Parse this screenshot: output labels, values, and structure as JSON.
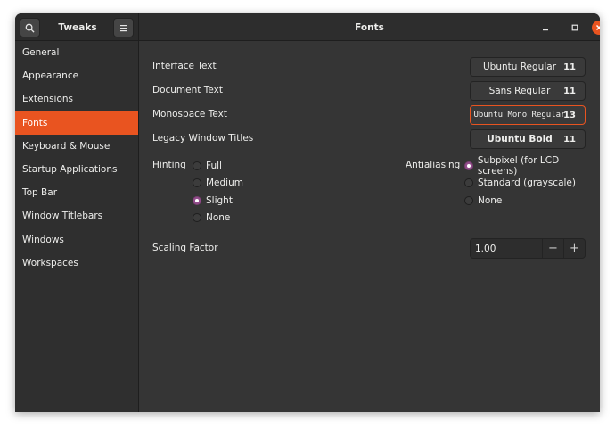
{
  "sidebar": {
    "title": "Tweaks",
    "items": [
      {
        "label": "General"
      },
      {
        "label": "Appearance"
      },
      {
        "label": "Extensions"
      },
      {
        "label": "Fonts"
      },
      {
        "label": "Keyboard & Mouse"
      },
      {
        "label": "Startup Applications"
      },
      {
        "label": "Top Bar"
      },
      {
        "label": "Window Titlebars"
      },
      {
        "label": "Windows"
      },
      {
        "label": "Workspaces"
      }
    ],
    "active_index": 3
  },
  "header": {
    "title": "Fonts"
  },
  "fonts": {
    "interface": {
      "label": "Interface Text",
      "font": "Ubuntu Regular",
      "size": "11"
    },
    "document": {
      "label": "Document Text",
      "font": "Sans Regular",
      "size": "11"
    },
    "monospace": {
      "label": "Monospace Text",
      "font": "Ubuntu Mono Regular",
      "size": "13"
    },
    "legacy": {
      "label": "Legacy Window Titles",
      "font": "Ubuntu Bold",
      "size": "11"
    }
  },
  "hinting": {
    "label": "Hinting",
    "options": [
      "Full",
      "Medium",
      "Slight",
      "None"
    ],
    "selected": "Slight"
  },
  "antialiasing": {
    "label": "Antialiasing",
    "options": [
      "Subpixel (for LCD screens)",
      "Standard (grayscale)",
      "None"
    ],
    "selected": "Subpixel (for LCD screens)"
  },
  "scaling": {
    "label": "Scaling Factor",
    "value": "1.00",
    "minus": "−",
    "plus": "+"
  },
  "colors": {
    "accent": "#e95420",
    "radio_checked": "#924d8b",
    "window_bg": "#353535"
  }
}
